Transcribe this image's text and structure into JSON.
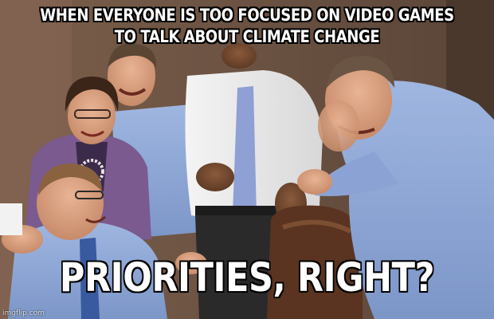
{
  "meme": {
    "top_text": "WHEN EVERYONE IS TOO FOCUSED ON VIDEO GAMES TO TALK ABOUT CLIMATE CHANGE",
    "bottom_text": "PRIORITIES, RIGHT?",
    "watermark": "imgflip.com"
  },
  "colors": {
    "caption_fill": "#ffffff",
    "caption_outline": "#000000",
    "wall": "#6e5646",
    "shirt_blue": "#8fa8d6",
    "shirt_white": "#eeeeee",
    "cardigan_purple": "#7a5a8f",
    "leather_brown": "#5a3420"
  }
}
